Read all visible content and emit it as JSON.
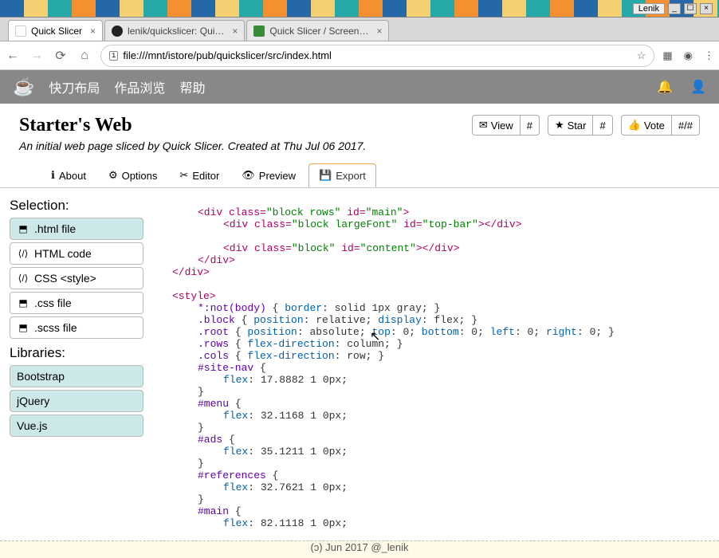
{
  "os": {
    "taskbar_label": "Lenik",
    "btn_min": "_",
    "btn_max": "☐",
    "btn_close": "×"
  },
  "browser": {
    "tabs": [
      {
        "title": "Quick Slicer",
        "close": "×"
      },
      {
        "title": "lenik/quickslicer: Qui…",
        "close": "×"
      },
      {
        "title": "Quick Slicer / Screen…",
        "close": "×"
      }
    ],
    "url": "file:///mnt/istore/pub/quickslicer/src/index.html"
  },
  "app": {
    "menu": {
      "m1": "快刀布局",
      "m2": "作品浏览",
      "m3": "帮助"
    }
  },
  "header": {
    "title": "Starter's Web",
    "subtitle": "An initial web page sliced by Quick Slicer. Created at Thu Jul 06 2017.",
    "view_label": "View",
    "view_count": "#",
    "star_label": "Star",
    "star_count": "#",
    "vote_label": "Vote",
    "vote_count": "#/#"
  },
  "apptabs": {
    "about": "About",
    "options": "Options",
    "editor": "Editor",
    "preview": "Preview",
    "export": "Export"
  },
  "sidebar": {
    "section1": "Selection:",
    "items1": {
      "html_file": ".html file",
      "html_code": "HTML code",
      "css_style": "CSS <style>",
      "css_file": ".css file",
      "scss_file": ".scss file"
    },
    "section2": "Libraries:",
    "items2": {
      "bootstrap": "Bootstrap",
      "jquery": "jQuery",
      "vue": "Vue.js"
    }
  },
  "code": {
    "l1_a": "<div class=",
    "l1_b": "\"block rows\"",
    "l1_c": " id=",
    "l1_d": "\"main\"",
    "l1_e": ">",
    "l2_a": "<div class=",
    "l2_b": "\"block largeFont\"",
    "l2_c": " id=",
    "l2_d": "\"top-bar\"",
    "l2_e": "></div>",
    "l3_a": "<div class=",
    "l3_b": "\"block\"",
    "l3_c": " id=",
    "l3_d": "\"content\"",
    "l3_e": "></div>",
    "l4": "</div>",
    "l5": "</div>",
    "l6": "<style>",
    "l7_a": "*:not(body)",
    "l7_b": " { ",
    "l7_c": "border",
    "l7_d": ": solid 1px gray; }",
    "l8_a": ".block",
    "l8_b": " { ",
    "l8_c": "position",
    "l8_d": ": relative; ",
    "l8_e": "display",
    "l8_f": ": flex; }",
    "l9_a": ".root",
    "l9_b": " { ",
    "l9_c": "position",
    "l9_d": ": absolute; ",
    "l9_e": "top",
    "l9_f": ": 0; ",
    "l9_g": "bottom",
    "l9_h": ": 0; ",
    "l9_i": "left",
    "l9_j": ": 0; ",
    "l9_k": "right",
    "l9_l": ": 0; }",
    "l10_a": ".rows",
    "l10_b": " { ",
    "l10_c": "flex-direction",
    "l10_d": ": column; }",
    "l11_a": ".cols",
    "l11_b": " { ",
    "l11_c": "flex-direction",
    "l11_d": ": row; }",
    "l12_a": "#site-nav",
    "l12_b": " {",
    "l13_a": "flex",
    "l13_b": ": 17.8882 1 0px;",
    "l14": "}",
    "l15_a": "#menu",
    "l15_b": " {",
    "l16_a": "flex",
    "l16_b": ": 32.1168 1 0px;",
    "l17": "}",
    "l18_a": "#ads",
    "l18_b": " {",
    "l19_a": "flex",
    "l19_b": ": 35.1211 1 0px;",
    "l20": "}",
    "l21_a": "#references",
    "l21_b": " {",
    "l22_a": "flex",
    "l22_b": ": 32.7621 1 0px;",
    "l23": "}",
    "l24_a": "#main",
    "l24_b": " {",
    "l25_a": "flex",
    "l25_b": ": 82.1118 1 0px;"
  },
  "footer": "(ɔ) Jun 2017 @_lenik"
}
